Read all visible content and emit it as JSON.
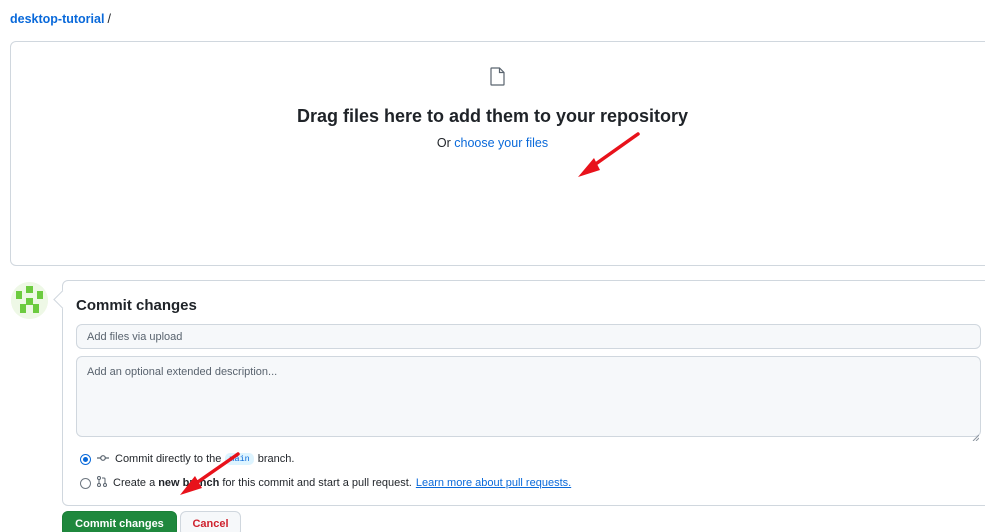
{
  "breadcrumb": {
    "repo": "desktop-tutorial",
    "separator": "/"
  },
  "dropzone": {
    "icon": "file-icon",
    "title": "Drag files here to add them to your repository",
    "prefix": "Or",
    "link": "choose your files"
  },
  "commit": {
    "title": "Commit changes",
    "summary_placeholder": "Add files via upload",
    "description_placeholder": "Add an optional extended description...",
    "option_direct": {
      "icon": "git-commit-icon",
      "before": "Commit directly to the",
      "branch": "main",
      "after": "branch.",
      "selected": true
    },
    "option_new_branch": {
      "icon": "git-pull-request-icon",
      "before": "Create a",
      "bold": "new branch",
      "after": "for this commit and start a pull request.",
      "link": "Learn more about pull requests.",
      "selected": false
    }
  },
  "buttons": {
    "commit": "Commit changes",
    "cancel": "Cancel"
  },
  "annotations": {
    "arrow_color": "#e8121b"
  },
  "colors": {
    "accent": "#0969da",
    "commit_button": "#1f883d",
    "cancel_text": "#cf222e"
  }
}
